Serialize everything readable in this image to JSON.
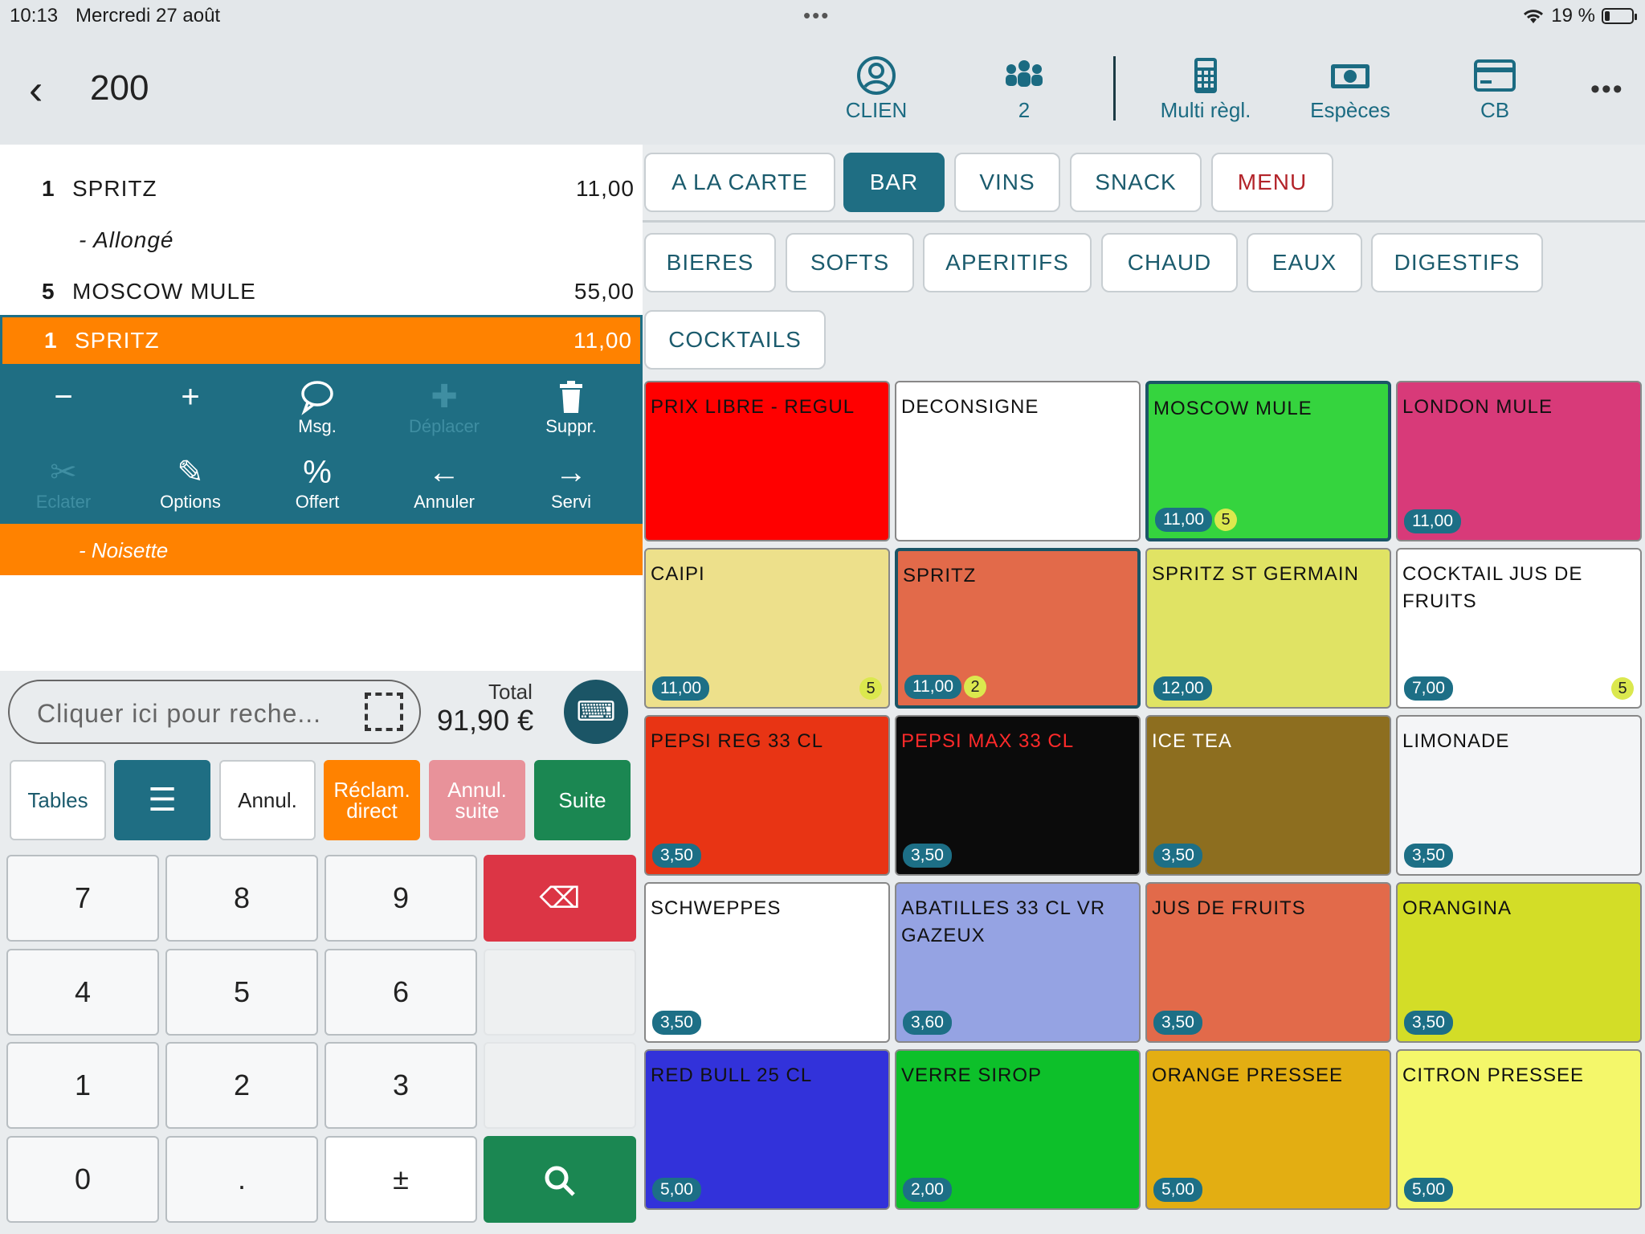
{
  "status": {
    "time": "10:13",
    "date": "Mercredi 27 août",
    "battery": "19 %"
  },
  "header": {
    "order_number": "200",
    "buttons": [
      {
        "label": "CLIEN",
        "icon": "user-circle-icon"
      },
      {
        "label": "2",
        "icon": "people-icon"
      },
      {
        "label": "Multi règl.",
        "icon": "calculator-icon"
      },
      {
        "label": "Espèces",
        "icon": "cash-icon"
      },
      {
        "label": "CB",
        "icon": "credit-card-icon"
      }
    ]
  },
  "ticket": {
    "lines": [
      {
        "qty": "1",
        "name": "SPRITZ",
        "price": "11,00"
      },
      {
        "qty": "",
        "name": "-  Allongé",
        "price": ""
      },
      {
        "qty": "5",
        "name": "MOSCOW MULE",
        "price": "55,00"
      },
      {
        "qty": "1",
        "name": "SPRITZ",
        "price": "11,00"
      }
    ],
    "sub_note": "- Noisette",
    "actions": [
      {
        "label": "",
        "icon": "minus-icon",
        "enabled": true
      },
      {
        "label": "",
        "icon": "plus-icon",
        "enabled": true
      },
      {
        "label": "Msg.",
        "icon": "message-icon",
        "enabled": true
      },
      {
        "label": "Déplacer",
        "icon": "move-icon",
        "enabled": false
      },
      {
        "label": "Suppr.",
        "icon": "trash-icon",
        "enabled": true
      },
      {
        "label": "Eclater",
        "icon": "scissors-icon",
        "enabled": false
      },
      {
        "label": "Options",
        "icon": "pencil-icon",
        "enabled": true
      },
      {
        "label": "Offert",
        "icon": "percent-icon",
        "enabled": true
      },
      {
        "label": "Annuler",
        "icon": "arrow-left-icon",
        "enabled": true
      },
      {
        "label": "Servi",
        "icon": "arrow-right-icon",
        "enabled": true
      }
    ]
  },
  "search": {
    "placeholder": "Cliquer ici pour reche..."
  },
  "total": {
    "label": "Total",
    "value": "91,90 €"
  },
  "bottom_buttons": [
    {
      "label": "Tables",
      "bg": "#ffffff",
      "fg": "#1b5b6d"
    },
    {
      "label": "",
      "bg": "#1f6e83",
      "fg": "#ffffff",
      "icon": "receipt-icon"
    },
    {
      "label": "Annul.",
      "bg": "#ffffff",
      "fg": "#222222"
    },
    {
      "label": "Réclam. direct",
      "bg": "#ff8200",
      "fg": "#ffffff"
    },
    {
      "label": "Annul. suite",
      "bg": "#e8929a",
      "fg": "#ffffff"
    },
    {
      "label": "Suite",
      "bg": "#1b8752",
      "fg": "#ffffff"
    }
  ],
  "keypad": [
    "7",
    "8",
    "9",
    "4",
    "5",
    "6",
    "1",
    "2",
    "3",
    "0",
    ".",
    "±"
  ],
  "categories": [
    "A LA CARTE",
    "BAR",
    "VINS",
    "SNACK",
    "MENU"
  ],
  "active_category": "BAR",
  "subcategories": [
    "BIERES",
    "SOFTS",
    "APERITIFS",
    "CHAUD",
    "EAUX",
    "DIGESTIFS",
    "COCKTAILS"
  ],
  "products": [
    {
      "name": "PRIX LIBRE - REGUL",
      "price": "",
      "badge": "",
      "bg": "#ff0000",
      "fg": "#111111"
    },
    {
      "name": "DECONSIGNE",
      "price": "",
      "badge": "",
      "bg": "#ffffff",
      "fg": "#111111"
    },
    {
      "name": "MOSCOW MULE",
      "price": "11,00",
      "badge": "5",
      "bg": "#35d43e",
      "fg": "#111111",
      "selected": true
    },
    {
      "name": "LONDON MULE",
      "price": "11,00",
      "badge": "",
      "bg": "#d83a79",
      "fg": "#111111"
    },
    {
      "name": "CAIPI",
      "price": "11,00",
      "badge": "5",
      "bg": "#ede08b",
      "fg": "#111111",
      "badge_right": true
    },
    {
      "name": "SPRITZ",
      "price": "11,00",
      "badge": "2",
      "bg": "#e26a4a",
      "fg": "#111111",
      "selected": true
    },
    {
      "name": "SPRITZ ST GERMAIN",
      "price": "12,00",
      "badge": "",
      "bg": "#e0e364",
      "fg": "#111111"
    },
    {
      "name": "COCKTAIL JUS DE FRUITS",
      "price": "7,00",
      "badge": "5",
      "bg": "#ffffff",
      "fg": "#111111",
      "badge_right": true
    },
    {
      "name": "PEPSI REG 33 CL",
      "price": "3,50",
      "badge": "",
      "bg": "#e83414",
      "fg": "#111111"
    },
    {
      "name": "PEPSI MAX 33 CL",
      "price": "3,50",
      "badge": "",
      "bg": "#0b0b0b",
      "fg": "#ff2a2a"
    },
    {
      "name": "ICE TEA",
      "price": "3,50",
      "badge": "",
      "bg": "#8d6e1f",
      "fg": "#ffffff"
    },
    {
      "name": "LIMONADE",
      "price": "3,50",
      "badge": "",
      "bg": "#f4f5f7",
      "fg": "#111111"
    },
    {
      "name": "SCHWEPPES",
      "price": "3,50",
      "badge": "",
      "bg": "#ffffff",
      "fg": "#111111"
    },
    {
      "name": "ABATILLES 33 CL VR GAZEUX",
      "price": "3,60",
      "badge": "",
      "bg": "#95a3e3",
      "fg": "#111111"
    },
    {
      "name": "JUS DE FRUITS",
      "price": "3,50",
      "badge": "",
      "bg": "#e26a4a",
      "fg": "#111111"
    },
    {
      "name": "ORANGINA",
      "price": "3,50",
      "badge": "",
      "bg": "#d3dd27",
      "fg": "#111111"
    },
    {
      "name": "RED BULL 25 CL",
      "price": "5,00",
      "badge": "",
      "bg": "#3232da",
      "fg": "#111111"
    },
    {
      "name": "VERRE SIROP",
      "price": "2,00",
      "badge": "",
      "bg": "#0dc02a",
      "fg": "#111111"
    },
    {
      "name": "ORANGE PRESSEE",
      "price": "5,00",
      "badge": "",
      "bg": "#e3ae12",
      "fg": "#111111"
    },
    {
      "name": "CITRON PRESSEE",
      "price": "5,00",
      "badge": "",
      "bg": "#f4f76a",
      "fg": "#111111"
    }
  ],
  "colors": {
    "accent": "#1f6e83",
    "selected_line": "#ff8200",
    "delete_key": "#dc3545",
    "search_key": "#1b8752"
  }
}
